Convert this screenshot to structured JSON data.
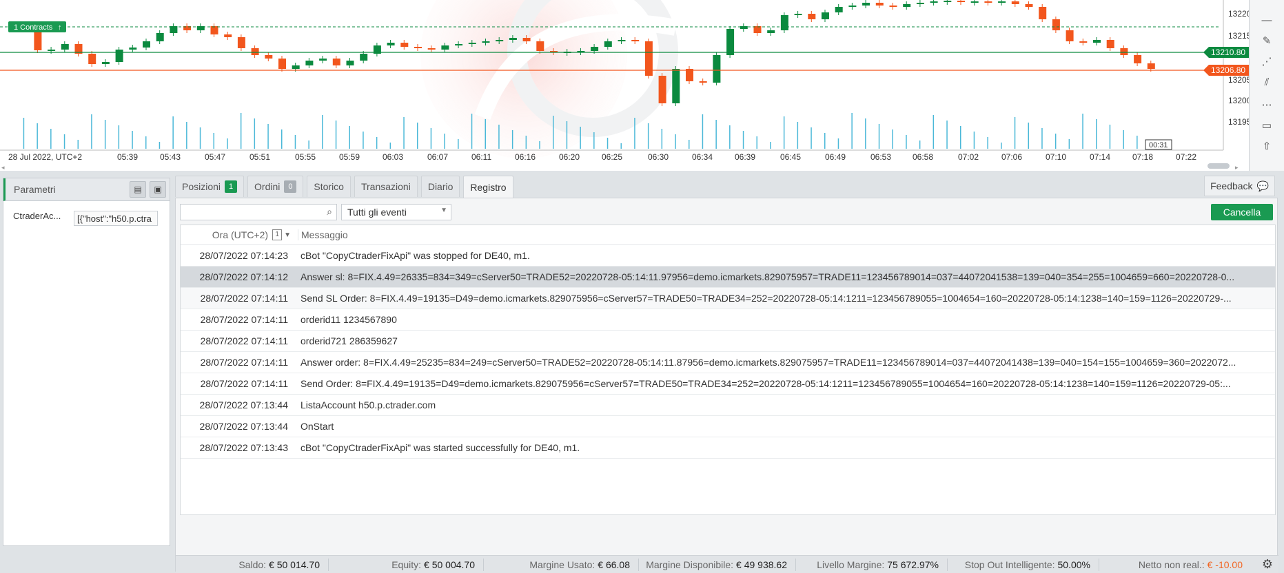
{
  "chart": {
    "price_labels": [
      "13220.0",
      "13215.0",
      "13205.0",
      "13200.0",
      "13195.0"
    ],
    "current_bid": "13210.80",
    "current_ask": "13206.80",
    "contracts_label": "1 Contracts",
    "countdown": "00:31",
    "time_labels": [
      "28 Jul 2022, UTC+2",
      "05:39",
      "05:43",
      "05:47",
      "05:51",
      "05:55",
      "05:59",
      "06:03",
      "06:07",
      "06:11",
      "06:16",
      "06:20",
      "06:25",
      "06:30",
      "06:34",
      "06:39",
      "06:45",
      "06:49",
      "06:53",
      "06:58",
      "07:02",
      "07:06",
      "07:10",
      "07:14",
      "07:18",
      "07:22"
    ],
    "colors": {
      "up": "#0b8a3f",
      "down": "#f2561d",
      "volume": "#4bb8d8"
    }
  },
  "params": {
    "title": "Parametri",
    "key": "CtraderAc...",
    "value": "[{\"host\":\"h50.p.ctra"
  },
  "tabs": [
    {
      "label": "Posizioni",
      "badge": "1"
    },
    {
      "label": "Ordini",
      "badge": "0"
    },
    {
      "label": "Storico"
    },
    {
      "label": "Transazioni"
    },
    {
      "label": "Diario"
    },
    {
      "label": "Registro"
    }
  ],
  "feedback_label": "Feedback",
  "toolbar": {
    "filter_value": "Tutti gli eventi",
    "cancel_label": "Cancella"
  },
  "log": {
    "col_time": "Ora (UTC+2)",
    "col_time_sort": "1",
    "col_message": "Messaggio",
    "rows": [
      {
        "time": "28/07/2022 07:14:23",
        "message": "cBot \"CopyCtraderFixApi\" was stopped for DE40, m1."
      },
      {
        "time": "28/07/2022 07:14:12",
        "message": "Answer sl: 8=FIX.4.49=26335=834=349=cServer50=TRADE52=20220728-05:14:11.97956=demo.icmarkets.829075957=TRADE11=123456789014=037=44072041538=139=040=354=255=1004659=660=20220728-0..."
      },
      {
        "time": "28/07/2022 07:14:11",
        "message": "Send SL Order: 8=FIX.4.49=19135=D49=demo.icmarkets.829075956=cServer57=TRADE50=TRADE34=252=20220728-05:14:1211=123456789055=1004654=160=20220728-05:14:1238=140=159=1126=20220729-..."
      },
      {
        "time": "28/07/2022 07:14:11",
        "message": "orderid11 1234567890"
      },
      {
        "time": "28/07/2022 07:14:11",
        "message": "orderid721 286359627"
      },
      {
        "time": "28/07/2022 07:14:11",
        "message": "Answer order: 8=FIX.4.49=25235=834=249=cServer50=TRADE52=20220728-05:14:11.87956=demo.icmarkets.829075957=TRADE11=123456789014=037=44072041438=139=040=154=155=1004659=360=2022072..."
      },
      {
        "time": "28/07/2022 07:14:11",
        "message": "Send Order: 8=FIX.4.49=19135=D49=demo.icmarkets.829075956=cServer57=TRADE50=TRADE34=252=20220728-05:14:1211=123456789055=1004654=160=20220728-05:14:1238=140=159=1126=20220729-05:..."
      },
      {
        "time": "28/07/2022 07:13:44",
        "message": "ListaAccount h50.p.ctrader.com"
      },
      {
        "time": "28/07/2022 07:13:44",
        "message": "OnStart"
      },
      {
        "time": "28/07/2022 07:13:43",
        "message": "cBot \"CopyCtraderFixApi\" was started successfully for DE40, m1."
      }
    ]
  },
  "status": [
    {
      "label": "Saldo:",
      "value": "€ 50 014.70"
    },
    {
      "label": "Equity:",
      "value": "€ 50 004.70"
    },
    {
      "label": "Margine Usato:",
      "value": "€ 66.08"
    },
    {
      "label": "Margine Disponibile:",
      "value": "€ 49 938.62"
    },
    {
      "label": "Livello Margine:",
      "value": "75 672.97%"
    },
    {
      "label": "Stop Out Intelligente:",
      "value": "50.00%"
    },
    {
      "label": "Netto non real.:",
      "value": "€ -10.00"
    }
  ]
}
